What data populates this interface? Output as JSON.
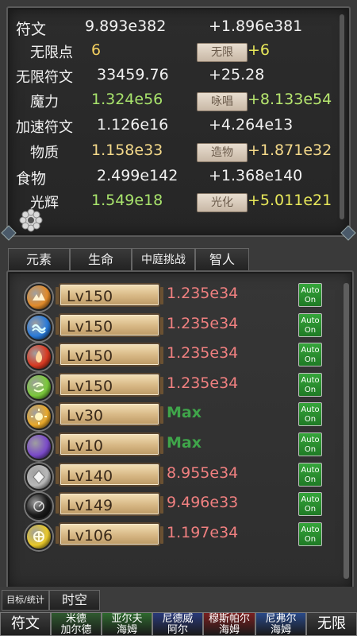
{
  "resources": [
    {
      "name": "符文",
      "value": "9.893e382",
      "rate": "+1.896e381",
      "value_color": "white",
      "rate_color": "white",
      "button": null
    },
    {
      "name": "无限点",
      "value": "6",
      "rate": "+6",
      "value_color": "count",
      "rate_color": "yellow",
      "button": "无限"
    },
    {
      "name": "无限符文",
      "value": "33459.76",
      "rate": "+25.28",
      "value_color": "white",
      "rate_color": "white",
      "button": null
    },
    {
      "name": "魔力",
      "value": "1.324e56",
      "rate": "+8.133e54",
      "value_color": "green",
      "rate_color": "green",
      "button": "咏唱"
    },
    {
      "name": "加速符文",
      "value": "1.126e16",
      "rate": "+4.264e13",
      "value_color": "white",
      "rate_color": "white",
      "button": null
    },
    {
      "name": "物质",
      "value": "1.158e33",
      "rate": "+1.871e32",
      "value_color": "gold",
      "rate_color": "gold",
      "button": "造物"
    },
    {
      "name": "食物",
      "value": "2.499e142",
      "rate": "+1.368e140",
      "value_color": "white",
      "rate_color": "white",
      "button": null
    },
    {
      "name": "光辉",
      "value": "1.549e18",
      "rate": "+5.011e21",
      "value_color": "green",
      "rate_color": "yellow",
      "button": "光化"
    }
  ],
  "tabs": [
    "元素",
    "生命",
    "中庭挑战",
    "智人"
  ],
  "elements": [
    {
      "icon": "earth-element-icon",
      "color": "#e08a2a",
      "level": "Lv150",
      "value": "1.235e34",
      "is_max": false
    },
    {
      "icon": "water-element-icon",
      "color": "#2a7ad8",
      "level": "Lv150",
      "value": "1.235e34",
      "is_max": false
    },
    {
      "icon": "fire-element-icon",
      "color": "#d83a22",
      "level": "Lv150",
      "value": "1.235e34",
      "is_max": false
    },
    {
      "icon": "wind-element-icon",
      "color": "#7ac83a",
      "level": "Lv150",
      "value": "1.235e34",
      "is_max": false
    },
    {
      "icon": "sun-element-icon",
      "color": "#e8a82a",
      "level": "Lv30",
      "value": "Max",
      "is_max": true
    },
    {
      "icon": "moon-element-icon",
      "color": "#7a4ac8",
      "level": "Lv10",
      "value": "Max",
      "is_max": true
    },
    {
      "icon": "metal-element-icon",
      "color": "#b8b8b8",
      "level": "Lv140",
      "value": "8.955e34",
      "is_max": false
    },
    {
      "icon": "void-element-icon",
      "color": "#1a1a1a",
      "level": "Lv149",
      "value": "9.496e33",
      "is_max": false
    },
    {
      "icon": "light-element-icon",
      "color": "#e8c82a",
      "level": "Lv106",
      "value": "1.197e34",
      "is_max": false
    }
  ],
  "auto": {
    "line1": "Auto",
    "line2": "On"
  },
  "sub_tabs": [
    "目标/统计",
    "时空"
  ],
  "nav": [
    {
      "label": "符文",
      "lines": [
        "符文"
      ]
    },
    {
      "label": "米德加尔德",
      "lines": [
        "米德",
        "加尔德"
      ]
    },
    {
      "label": "亚尔夫海姆",
      "lines": [
        "亚尔夫",
        "海姆"
      ]
    },
    {
      "label": "尼德威阿尔",
      "lines": [
        "尼德威",
        "阿尔"
      ]
    },
    {
      "label": "穆斯帕尔海姆",
      "lines": [
        "穆斯帕尔",
        "海姆"
      ]
    },
    {
      "label": "尼弗尔海姆",
      "lines": [
        "尼弗尔",
        "海姆"
      ]
    },
    {
      "label": "无限",
      "lines": [
        "无限"
      ]
    }
  ],
  "nav_colors": [
    "#2a2a2a",
    "#2f5a2f",
    "#2f6a2f",
    "#2a3a7a",
    "#7a2020",
    "#2a4a8a",
    "#2a2a2a"
  ]
}
